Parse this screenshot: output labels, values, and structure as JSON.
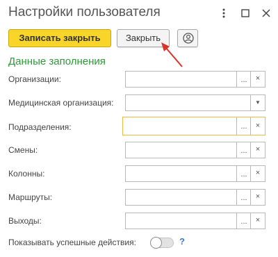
{
  "window": {
    "title": "Настройки пользователя",
    "controls": [
      "more-vertical-icon",
      "maximize-icon",
      "close-icon"
    ]
  },
  "toolbar": {
    "save_close_label": "Записать закрыть",
    "close_label": "Закрыть",
    "user_icon": "user-circle-icon"
  },
  "section": {
    "title": "Данные заполнения"
  },
  "fields": [
    {
      "label": "Организации:",
      "value": "",
      "control": "ellipsis-clear"
    },
    {
      "label": "Медицинская организация:",
      "value": "",
      "control": "dropdown"
    },
    {
      "label": "Подразделения:",
      "value": "",
      "control": "ellipsis-clear",
      "focused": true
    },
    {
      "label": "Смены:",
      "value": "",
      "control": "ellipsis-clear"
    },
    {
      "label": "Колонны:",
      "value": "",
      "control": "ellipsis-clear"
    },
    {
      "label": "Маршруты:",
      "value": "",
      "control": "ellipsis-clear"
    },
    {
      "label": "Выходы:",
      "value": "",
      "control": "ellipsis-clear"
    }
  ],
  "buttons": {
    "ellipsis": "...",
    "clear": "×",
    "dropdown": "▼"
  },
  "toggle": {
    "label": "Показывать успешные действия:",
    "on": false,
    "help": "?"
  },
  "colors": {
    "primary_button": "#f8d528",
    "section_title": "#2d9a38",
    "focus_border": "#efb93c",
    "annotation_arrow": "#d9342b",
    "help": "#3a7bd5"
  }
}
